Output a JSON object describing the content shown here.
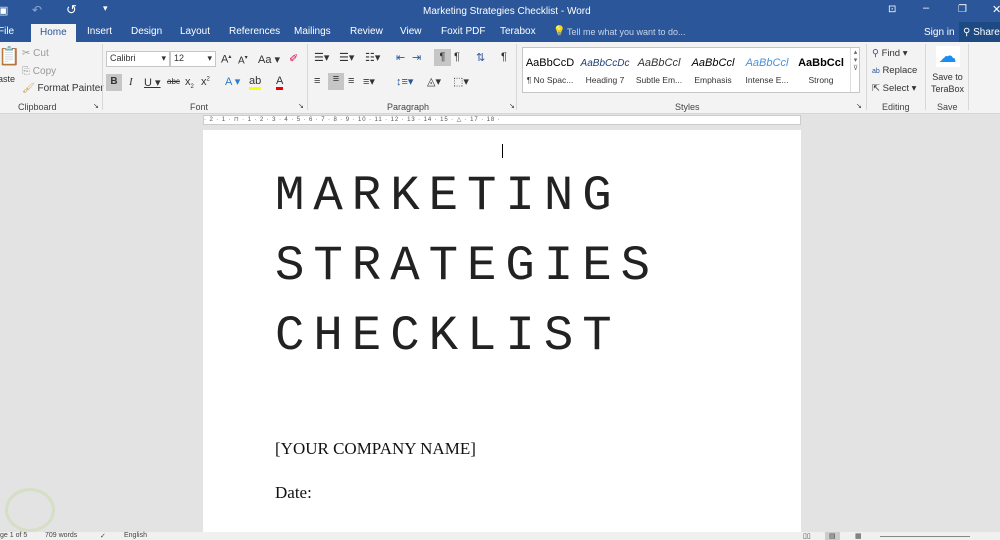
{
  "window": {
    "title": "Marketing Strategies Checklist - Word"
  },
  "qat": {
    "save": "save-icon",
    "undo": "undo-icon",
    "redo": "redo-icon",
    "customize": "customize-icon"
  },
  "tabs": [
    "File",
    "Home",
    "Insert",
    "Design",
    "Layout",
    "References",
    "Mailings",
    "Review",
    "View",
    "Foxit PDF",
    "Terabox"
  ],
  "tell_me": "Tell me what you want to do...",
  "sign_in": "Sign in",
  "share": "Share",
  "clipboard": {
    "paste": "aste",
    "cut": "Cut",
    "copy": "Copy",
    "format_painter": "Format Painter",
    "label": "Clipboard"
  },
  "font": {
    "name": "Calibri",
    "size": "12",
    "label": "Font",
    "case": "Aa"
  },
  "paragraph": {
    "label": "Paragraph"
  },
  "styles": {
    "label": "Styles",
    "items": [
      {
        "preview": "AaBbCcD",
        "name": "¶ No Spac..."
      },
      {
        "preview": "AaBbCcDc",
        "name": "Heading 7"
      },
      {
        "preview": "AaBbCcl",
        "name": "Subtle Em..."
      },
      {
        "preview": "AaBbCcl",
        "name": "Emphasis"
      },
      {
        "preview": "AaBbCcl",
        "name": "Intense E..."
      },
      {
        "preview": "AaBbCcl",
        "name": "Strong"
      }
    ]
  },
  "editing": {
    "find": "Find",
    "replace": "Replace",
    "select": "Select",
    "label": "Editing"
  },
  "save": {
    "button": "Save to TeraBox",
    "label": "Save"
  },
  "ruler": "· 2 · 1 · ⊓ · 1 · 2 · 3 · 4 · 5 · 6 · 7 · 8 · 9 · 10 · 11 · 12 · 13 · 14 · 15 · △ · 17 · 18 ·",
  "document": {
    "title_lines": [
      "MARKETING",
      "STRATEGIES",
      "CHECKLIST"
    ],
    "company": "[YOUR COMPANY NAME]",
    "date": "Date:"
  },
  "status": {
    "page": "ge 1 of 5",
    "words": "709 words",
    "language": "English"
  }
}
